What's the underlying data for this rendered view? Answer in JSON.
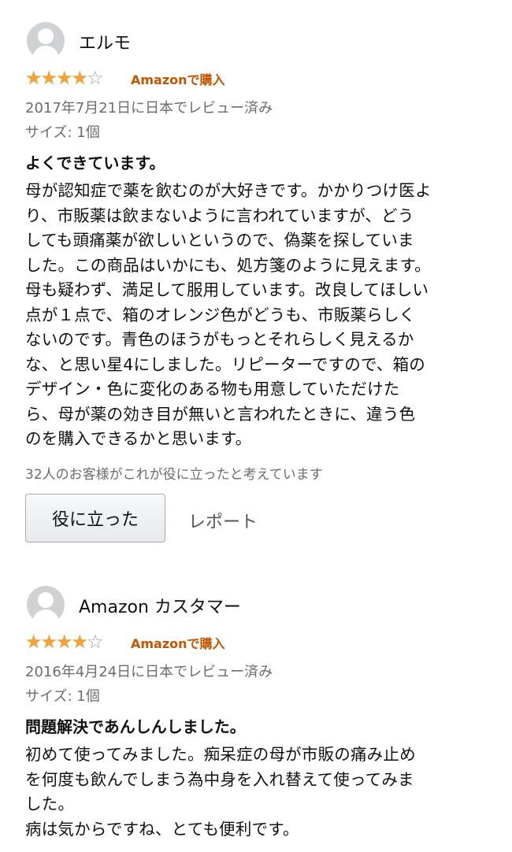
{
  "reviews": [
    {
      "reviewer": "エルモ",
      "rating": 4,
      "max_rating": 5,
      "verified_badge": "Amazonで購入",
      "date": "2017年7月21日に日本でレビュー済み",
      "variant": "サイズ: 1個",
      "title": "よくできています。",
      "body_lines": [
        "母が認知症で薬を飲むのが大好きです。かかりつけ医よ",
        "り、市販薬は飲まないように言われていますが、どう",
        "しても頭痛薬が欲しいというので、偽薬を探していま",
        "した。この商品はいかにも、処方箋のように見えます。",
        "母も疑わず、満足して服用しています。改良してほしい",
        "点が１点で、箱のオレンジ色がどうも、市販薬らしく",
        "ないのです。青色のほうがもっとそれらしく見えるか",
        "な、と思い星4にしました。リピーターですので、箱の",
        "デザイン・色に変化のある物も用意していただけた",
        "ら、母が薬の効き目が無いと言われたときに、違う色",
        "のを購入できるかと思います。"
      ],
      "helpful_count_text": "32人のお客様がこれが役に立ったと考えています",
      "helpful_button": "役に立った",
      "report_link": "レポート"
    },
    {
      "reviewer": "Amazon カスタマー",
      "rating": 4,
      "max_rating": 5,
      "verified_badge": "Amazonで購入",
      "date": "2016年4月24日に日本でレビュー済み",
      "variant": "サイズ: 1個",
      "title": "問題解決であんしんしました。",
      "body_lines": [
        "初めて使ってみました。痴呆症の母が市販の痛み止め",
        "を何度も飲んでしまう為中身を入れ替えて使ってみま",
        "した。",
        "病は気からですね、とても便利です。"
      ]
    }
  ],
  "icons": {
    "avatar": "user-avatar-icon",
    "star_full": "star-filled-icon",
    "star_empty": "star-outline-icon"
  },
  "colors": {
    "star": "#f1a33b",
    "badge": "#c45500",
    "meta_text": "#6c6c6c"
  }
}
